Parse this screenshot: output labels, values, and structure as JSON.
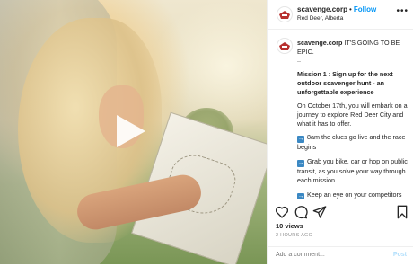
{
  "post": {
    "media_type": "video",
    "username": "scavenge.corp",
    "separator": "•",
    "follow_label": "Follow",
    "location": "Red Deer, Alberta",
    "more_icon": "more-horizontal-icon",
    "caption": {
      "username": "scavenge.corp",
      "intro": "IT'S GOING TO BE EPIC.",
      "dots": "..",
      "mission_title": "Mission 1 : Sign up for the next outdoor scavenger hunt - an unforgettable experience",
      "paragraph": "On October 17th, you will embark on a journey to explore Red Deer City and what it has to offer.",
      "bullets": [
        {
          "icon": "arrow-right-emoji-icon",
          "text": "8am the clues go live and the race begins"
        },
        {
          "icon": "arrow-right-emoji-icon",
          "text": "Grab you bike, car or hop on public transit, as you solve your way through each mission"
        },
        {
          "icon": "arrow-right-emoji-icon",
          "text": "Keep an eye on your competitors with our real-time map @poptochase"
        }
      ]
    },
    "views": "10 views",
    "time_ago": "2 HOURS AGO",
    "comment_placeholder": "Add a comment...",
    "post_label": "Post",
    "colors": {
      "link": "#0095f6",
      "post_disabled": "#b2dffc",
      "emoji_blue": "#3b88c3"
    }
  }
}
